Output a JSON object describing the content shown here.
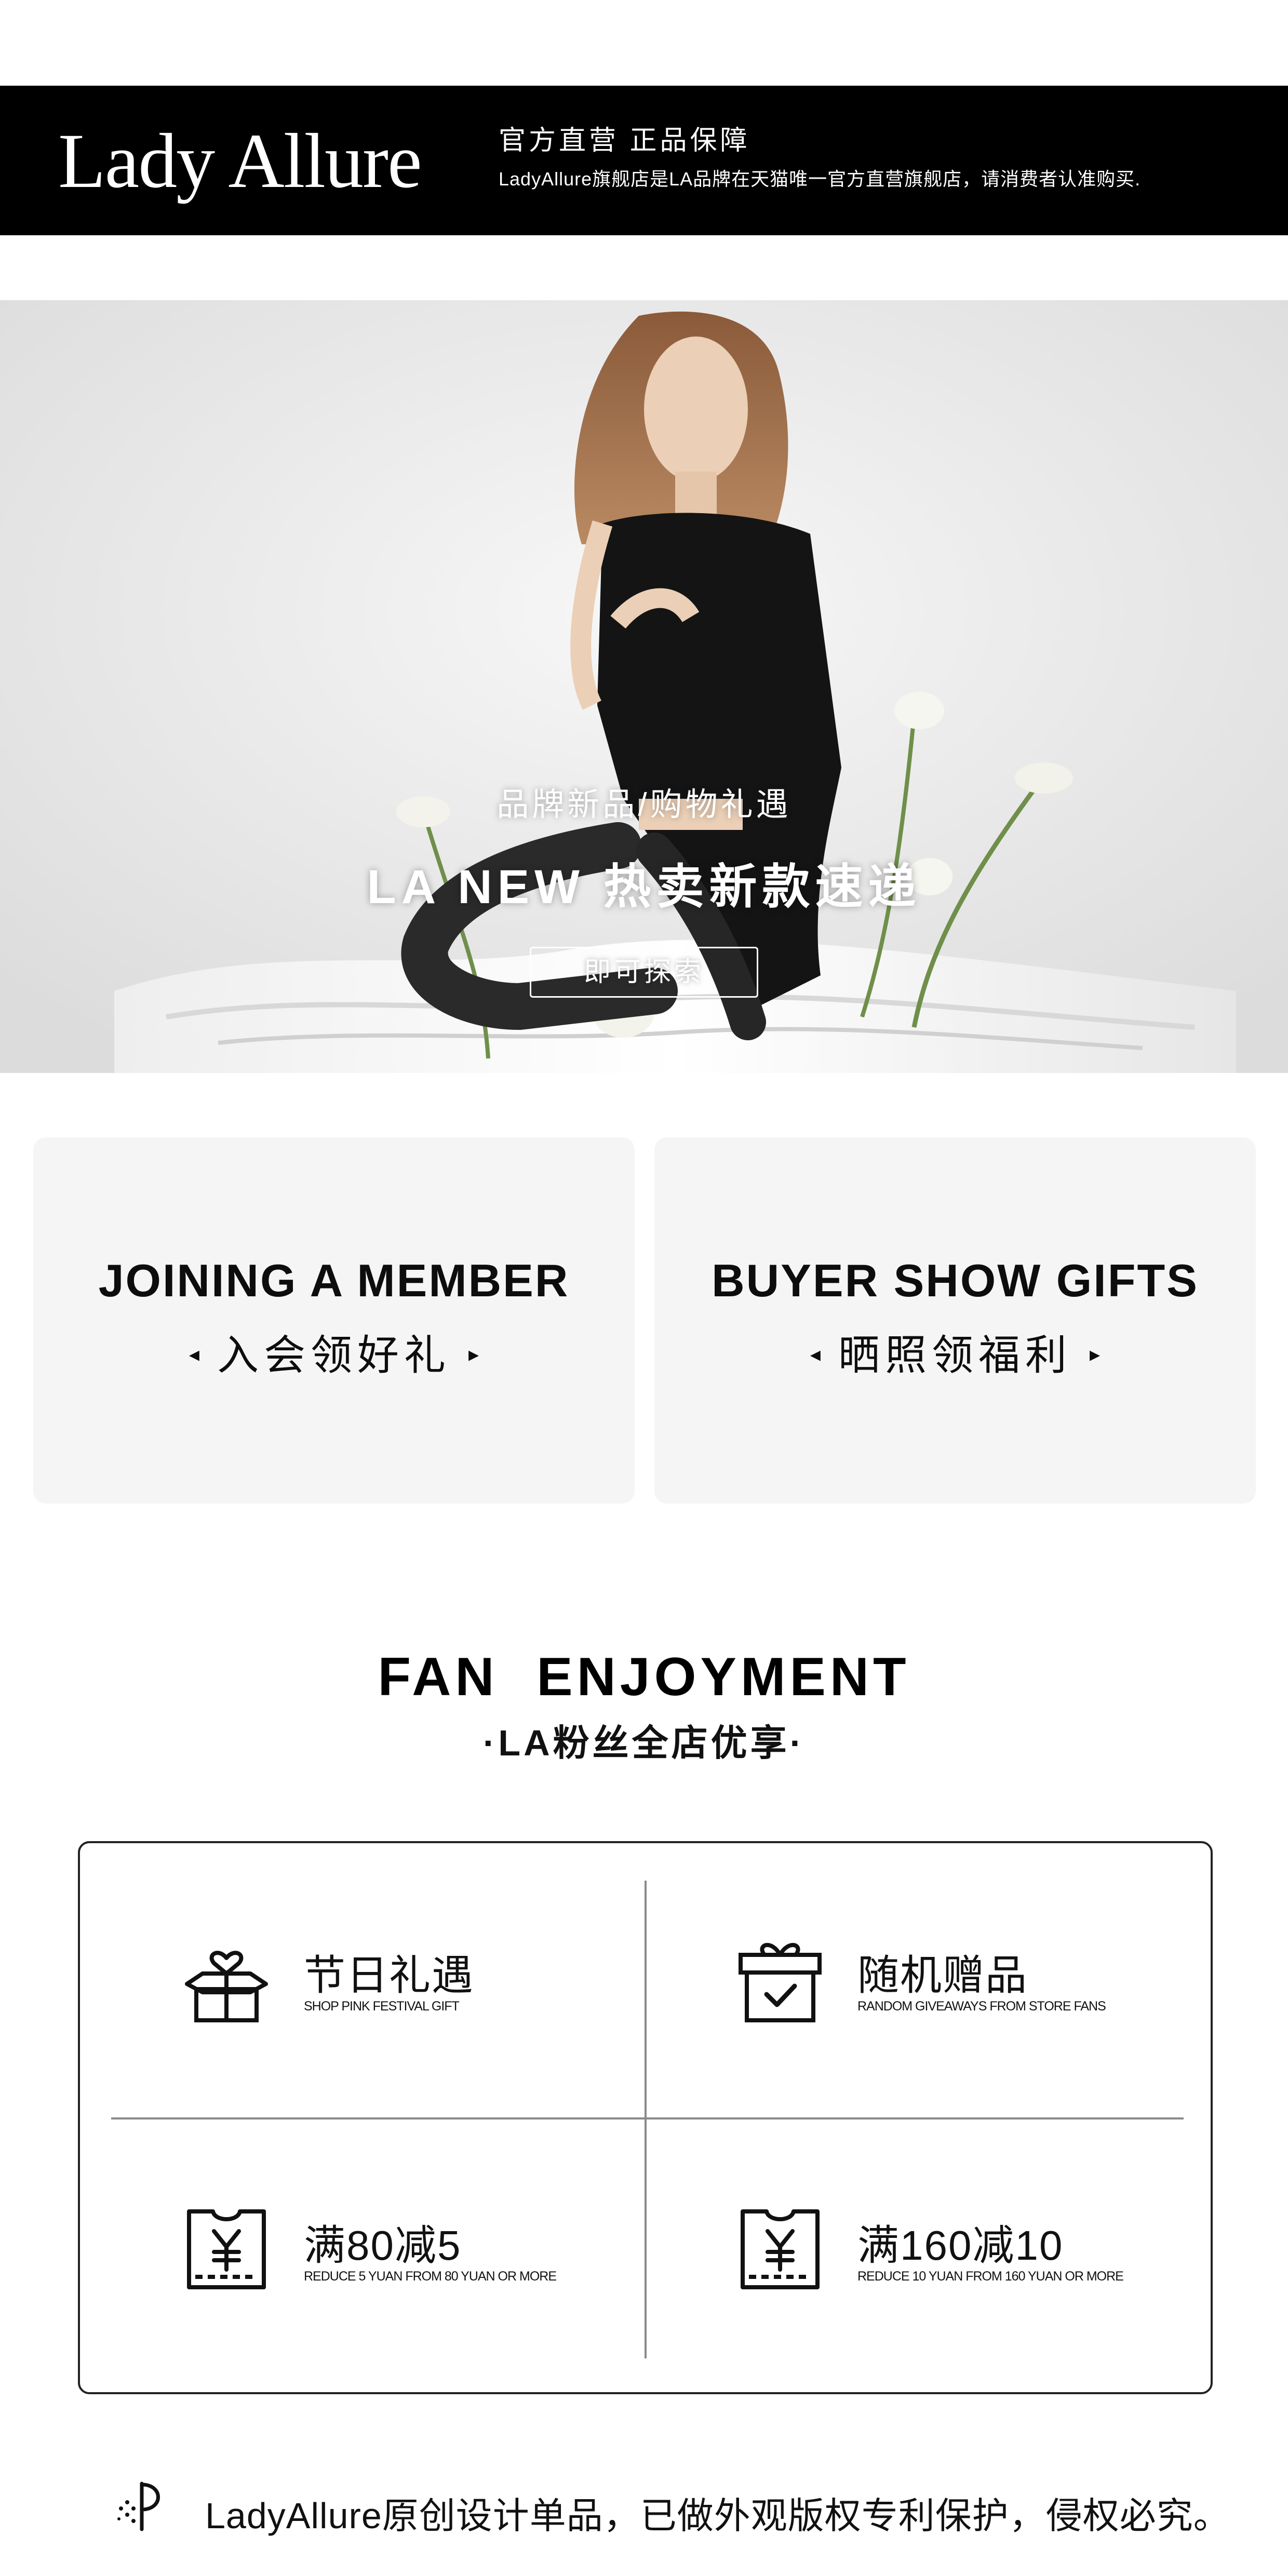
{
  "brand": {
    "logo": "Lady Allure",
    "slogan": "官方直营 正品保障",
    "description": "LadyAllure旗舰店是LA品牌在天猫唯一官方直营旗舰店，请消费者认准购买."
  },
  "hero": {
    "tagline": "品牌新品/购物礼遇",
    "title": "LA NEW 热卖新款速递",
    "cta_label": "即可探索"
  },
  "promos": [
    {
      "title_en": "JOINING A MEMBER",
      "title_cn": "入会领好礼"
    },
    {
      "title_en": "BUYER SHOW GIFTS",
      "title_cn": "晒照领福利"
    }
  ],
  "fan_section": {
    "title": "FAN  ENJOYMENT",
    "subtitle": "·LA粉丝全店优享·"
  },
  "benefits": [
    {
      "title": "节日礼遇",
      "subtitle": "SHOP PINK FESTIVAL GIFT",
      "icon": "gift-heart-icon"
    },
    {
      "title": "随机赠品",
      "subtitle": "RANDOM GIVEAWAYS FROM STORE FANS",
      "icon": "gift-box-check-icon"
    },
    {
      "title": "满80减5",
      "subtitle": "REDUCE 5 YUAN FROM 80 YUAN OR MORE",
      "icon": "yuan-coupon-icon"
    },
    {
      "title": "满160减10",
      "subtitle": "REDUCE 10 YUAN FROM 160 YUAN OR MORE",
      "icon": "yuan-coupon-icon"
    }
  ],
  "footer": {
    "note": "LadyAllure原创设计单品，已做外观版权专利保护，侵权必究。",
    "icon": "brand-mark-icon"
  },
  "colors": {
    "banner_bg": "#000000",
    "card_bg": "#f5f5f5",
    "text": "#111111"
  }
}
